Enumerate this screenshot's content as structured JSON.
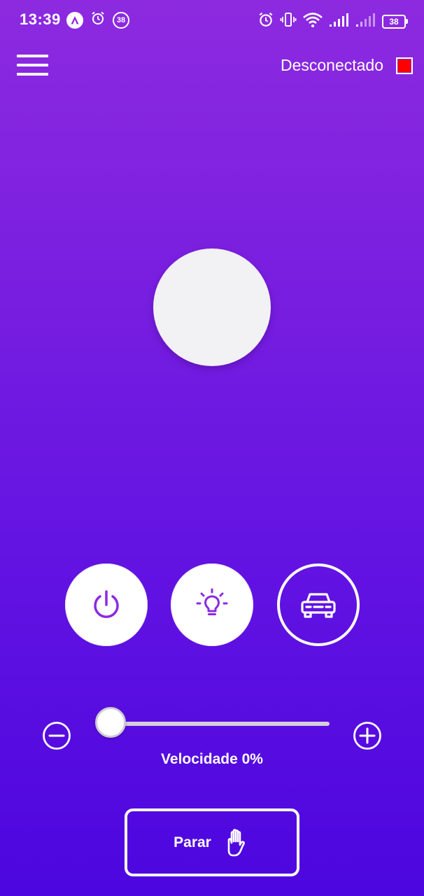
{
  "status_bar": {
    "time": "13:39",
    "notification_badge": "38",
    "battery_level": "38",
    "icons": [
      "app-a-icon",
      "alarm-icon",
      "badge-38-icon",
      "alarm-icon",
      "vibrate-icon",
      "wifi-icon",
      "signal-icon",
      "signal-weak-icon",
      "battery-icon"
    ]
  },
  "header": {
    "menu_icon": "hamburger-menu-icon",
    "connection_status": "Desconectado",
    "connection_color": "#ff0000"
  },
  "controls": {
    "joystick_icon": "joystick-knob",
    "power_icon": "power-icon",
    "light_icon": "lightbulb-icon",
    "car_icon": "car-icon"
  },
  "speed": {
    "label": "Velocidade",
    "value": 0,
    "display": "Velocidade 0%",
    "minus_icon": "minus-circle-icon",
    "plus_icon": "plus-circle-icon"
  },
  "stop": {
    "label": "Parar",
    "icon": "hand-stop-icon"
  },
  "colors": {
    "gradient_top": "#8d2ae0",
    "gradient_bottom": "#4c06df",
    "accent": "#8a2be2"
  }
}
